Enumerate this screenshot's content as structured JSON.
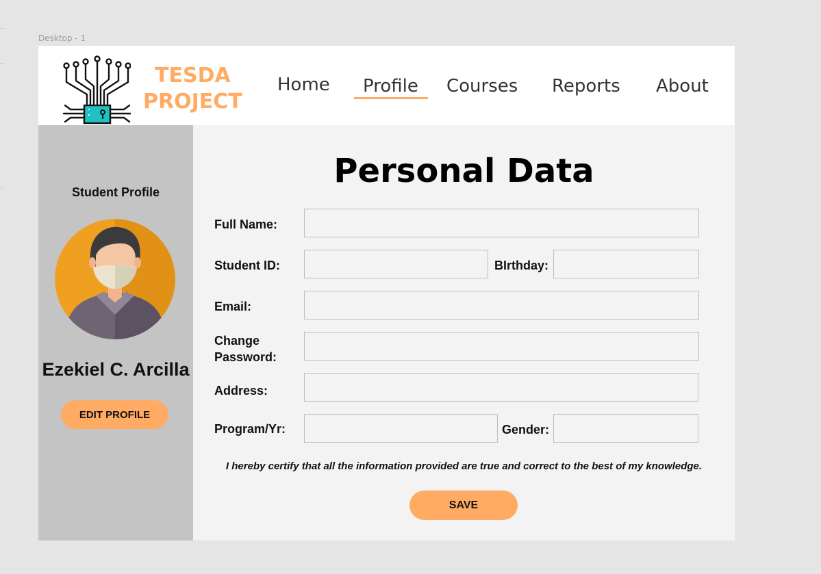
{
  "canvas": {
    "frame_label": "Desktop - 1"
  },
  "header": {
    "brand_line1": "TESDA",
    "brand_line2": "PROJECT",
    "logo_icon": "circuit-chip-icon",
    "nav": [
      {
        "label": "Home",
        "active": false
      },
      {
        "label": "Profile",
        "active": true
      },
      {
        "label": "Courses",
        "active": false
      },
      {
        "label": "Reports",
        "active": false
      },
      {
        "label": "About",
        "active": false
      }
    ]
  },
  "sidebar": {
    "title": "Student Profile",
    "avatar_icon": "masked-student-avatar-icon",
    "name": "Ezekiel C. Arcilla",
    "edit_label": "EDIT PROFILE"
  },
  "form": {
    "title": "Personal Data",
    "full_name_label": "Full Name:",
    "student_id_label": "Student ID:",
    "birthday_label": "BIrthday:",
    "email_label": "Email:",
    "change_password_label_line1": "Change",
    "change_password_label_line2": "Password:",
    "address_label": "Address:",
    "program_label": "Program/Yr:",
    "gender_label": "Gender:",
    "values": {
      "full_name": "",
      "student_id": "",
      "birthday": "",
      "email": "",
      "password": "",
      "address": "",
      "program": "",
      "gender": ""
    },
    "certify": "I hereby certify that all the information provided are true and correct to the best of my knowledge.",
    "save_label": "SAVE"
  },
  "colors": {
    "accent": "#ffab63",
    "sidebar_bg": "#c4c4c4",
    "panel_bg": "#f3f3f3",
    "chip": "#1fc1c3"
  }
}
